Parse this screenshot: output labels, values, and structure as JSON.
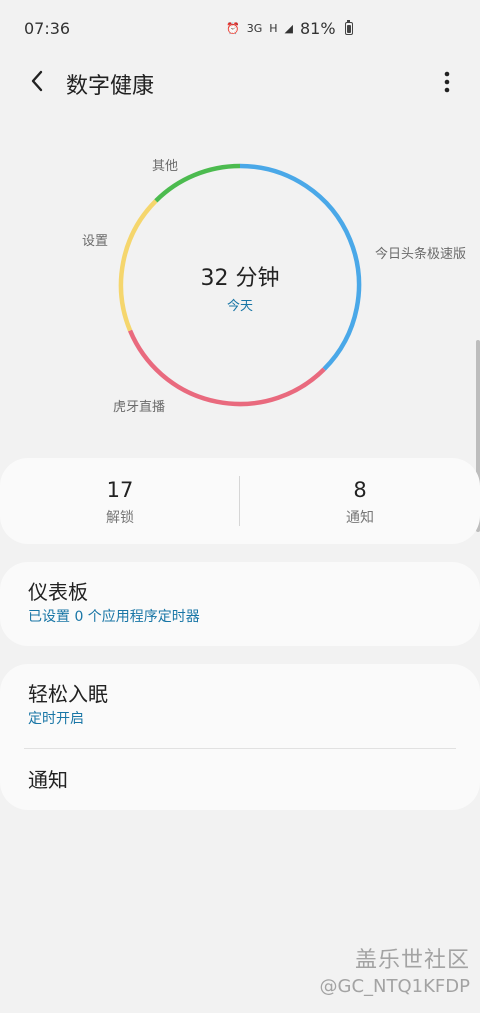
{
  "status_bar": {
    "time": "07:36",
    "signal_3g": "3G",
    "signal_h": "H",
    "battery_percent": "81%"
  },
  "header": {
    "title": "数字健康"
  },
  "chart_data": {
    "type": "donut",
    "center_value": "32 分钟",
    "center_label": "今天",
    "series": [
      {
        "name": "今日头条极速版",
        "value": 12,
        "color": "#4aa8e8"
      },
      {
        "name": "虎牙直播",
        "value": 10,
        "color": "#e96a7e"
      },
      {
        "name": "设置",
        "value": 6,
        "color": "#f5d66d"
      },
      {
        "name": "其他",
        "value": 4,
        "color": "#4cbb4f"
      }
    ]
  },
  "stats": {
    "unlocks_value": "17",
    "unlocks_label": "解锁",
    "notifications_value": "8",
    "notifications_label": "通知"
  },
  "dashboard": {
    "title": "仪表板",
    "subtitle": "已设置 0 个应用程序定时器"
  },
  "sleep": {
    "title": "轻松入眠",
    "subtitle": "定时开启"
  },
  "notifications": {
    "title": "通知"
  },
  "watermark": {
    "title": "盖乐世社区",
    "handle": "@GC_NTQ1KFDP"
  },
  "colors": {
    "accent": "#1976a6",
    "background": "#f2f2f2",
    "card": "#fafafa"
  }
}
